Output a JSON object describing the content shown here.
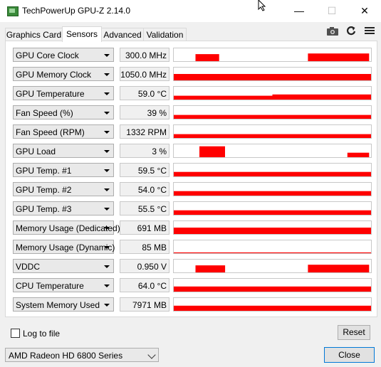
{
  "window": {
    "title": "TechPowerUp GPU-Z 2.14.0",
    "controls": {
      "minimize": "—",
      "maximize": "☐",
      "close": "✕"
    }
  },
  "tabs": [
    {
      "label": "Graphics Card",
      "active": false
    },
    {
      "label": "Sensors",
      "active": true
    },
    {
      "label": "Advanced",
      "active": false
    },
    {
      "label": "Validation",
      "active": false
    }
  ],
  "toolbar": {
    "icons": [
      "camera-icon",
      "refresh-icon",
      "menu-icon"
    ]
  },
  "colors": {
    "graph": "#ff0000",
    "accent": "#0078d7"
  },
  "sensors": [
    {
      "label": "GPU Core Clock",
      "value": "300.0 MHz",
      "graph": [
        {
          "s": 0.11,
          "e": 0.23,
          "v": 0.55
        },
        {
          "s": 0.68,
          "e": 0.99,
          "v": 0.6
        }
      ]
    },
    {
      "label": "GPU Memory Clock",
      "value": "1050.0 MHz",
      "graph": [
        {
          "s": 0.0,
          "e": 1.0,
          "v": 0.5
        }
      ]
    },
    {
      "label": "GPU Temperature",
      "value": "59.0 °C",
      "graph": [
        {
          "s": 0.0,
          "e": 0.5,
          "v": 0.3
        },
        {
          "s": 0.5,
          "e": 1.0,
          "v": 0.4
        }
      ]
    },
    {
      "label": "Fan Speed (%)",
      "value": "39 %",
      "graph": [
        {
          "s": 0.0,
          "e": 1.0,
          "v": 0.3
        }
      ]
    },
    {
      "label": "Fan Speed (RPM)",
      "value": "1332 RPM",
      "graph": [
        {
          "s": 0.0,
          "e": 1.0,
          "v": 0.3
        }
      ]
    },
    {
      "label": "GPU Load",
      "value": "3 %",
      "graph": [
        {
          "s": 0.13,
          "e": 0.26,
          "v": 0.85
        },
        {
          "s": 0.88,
          "e": 0.99,
          "v": 0.35
        }
      ]
    },
    {
      "label": "GPU Temp. #1",
      "value": "59.5 °C",
      "graph": [
        {
          "s": 0.0,
          "e": 1.0,
          "v": 0.35
        }
      ]
    },
    {
      "label": "GPU Temp. #2",
      "value": "54.0 °C",
      "graph": [
        {
          "s": 0.0,
          "e": 1.0,
          "v": 0.35
        }
      ]
    },
    {
      "label": "GPU Temp. #3",
      "value": "55.5 °C",
      "graph": [
        {
          "s": 0.0,
          "e": 1.0,
          "v": 0.35
        }
      ]
    },
    {
      "label": "Memory Usage (Dedicated)",
      "value": "691 MB",
      "graph": [
        {
          "s": 0.0,
          "e": 1.0,
          "v": 0.5
        }
      ]
    },
    {
      "label": "Memory Usage (Dynamic)",
      "value": "85 MB",
      "graph": [
        {
          "s": 0.0,
          "e": 1.0,
          "v": 0.06
        }
      ]
    },
    {
      "label": "VDDC",
      "value": "0.950 V",
      "graph": [
        {
          "s": 0.11,
          "e": 0.26,
          "v": 0.55
        },
        {
          "s": 0.68,
          "e": 0.99,
          "v": 0.6
        }
      ]
    },
    {
      "label": "CPU Temperature",
      "value": "64.0 °C",
      "graph": [
        {
          "s": 0.0,
          "e": 1.0,
          "v": 0.4
        }
      ]
    },
    {
      "label": "System Memory Used",
      "value": "7971 MB",
      "graph": [
        {
          "s": 0.0,
          "e": 1.0,
          "v": 0.4
        }
      ]
    }
  ],
  "footer": {
    "log_label": "Log to file",
    "log_checked": false,
    "reset_label": "Reset",
    "gpu_selected": "AMD Radeon HD 6800 Series",
    "close_label": "Close"
  }
}
